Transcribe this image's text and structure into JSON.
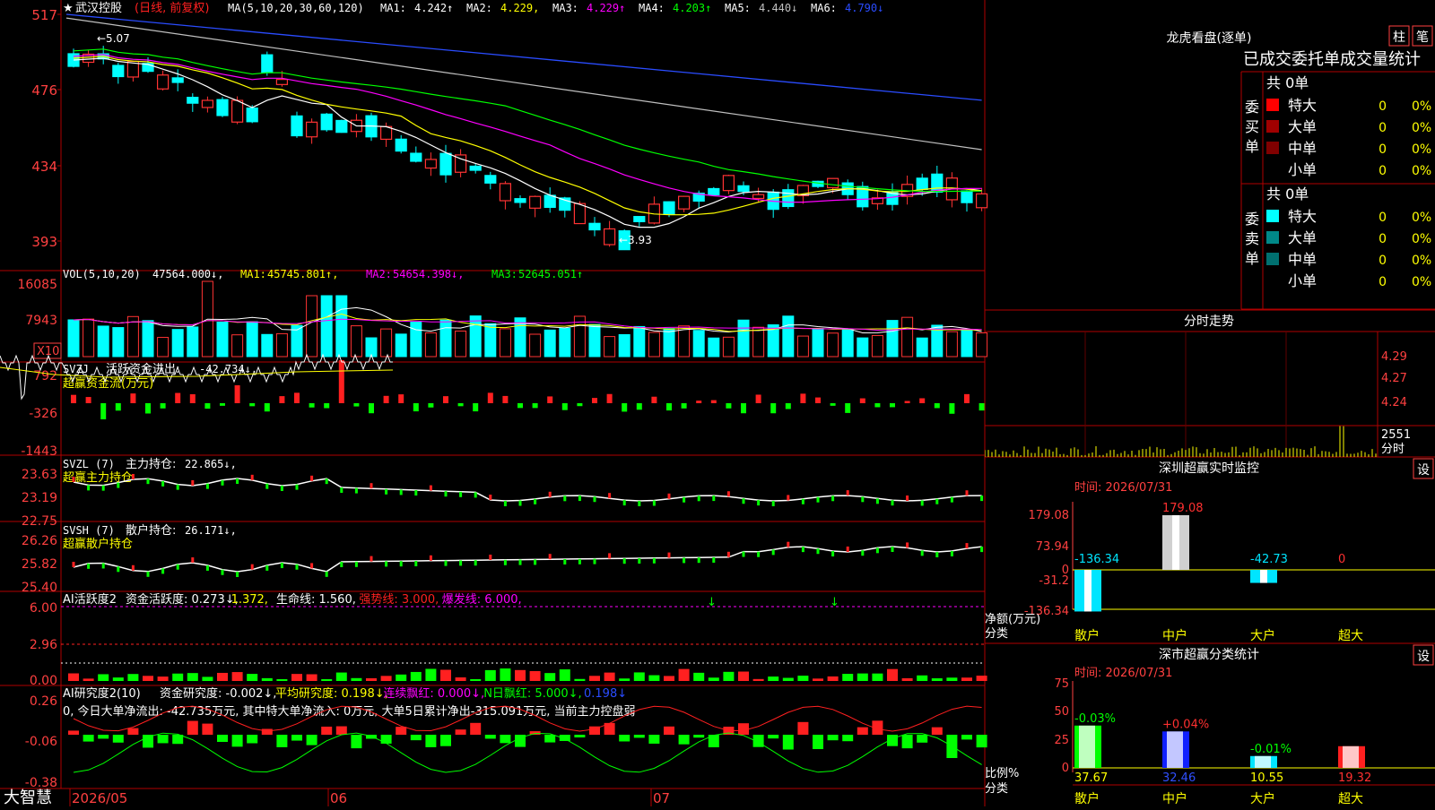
{
  "app": {
    "brand": "大智慧"
  },
  "kline_header": {
    "star": "★",
    "stock": "武汉控股",
    "mode": "(日线, 前复权)",
    "ma_title": "MA(5,10,20,30,60,120)",
    "items": [
      {
        "label": "MA1:",
        "value": "4.242↑",
        "color": "#ffffff"
      },
      {
        "label": "MA2:",
        "value": "4.229,",
        "color": "#ffff00"
      },
      {
        "label": "MA3:",
        "value": "4.229↑",
        "color": "#ff00ff"
      },
      {
        "label": "MA4:",
        "value": "4.203↑",
        "color": "#00ff00"
      },
      {
        "label": "MA5:",
        "value": "4.440↓",
        "color": "#c0c0c0"
      },
      {
        "label": "MA6:",
        "value": "4.790↓",
        "color": "#2a4cff"
      }
    ],
    "high_label": "←5.07",
    "low_label": "←3.93",
    "yaxis": [
      "517",
      "476",
      "434",
      "393"
    ]
  },
  "vol_header": {
    "title": "VOL(5,10,20)",
    "value": "47564.000↓,",
    "items": [
      {
        "label": "MA1:",
        "value": "45745.801↑,",
        "color": "#ffff00"
      },
      {
        "label": "MA2:",
        "value": "54654.398↓,",
        "color": "#ff00ff"
      },
      {
        "label": "MA3:",
        "value": "52645.051↑",
        "color": "#00ff00"
      }
    ],
    "yaxis": [
      "16085",
      "7943"
    ],
    "unit": "X10"
  },
  "svzj": {
    "title": "SVZJ",
    "desc": "活跃资金进出:",
    "value": "-42.734↓,",
    "sub": "超赢资金流(万元)",
    "yaxis": [
      "792",
      "-326",
      "-1443"
    ]
  },
  "svzl": {
    "title": "SVZL (7)",
    "desc": "主力持仓:",
    "value": "22.865↓,",
    "sub": "超赢主力持仓",
    "yaxis": [
      "23.63",
      "23.19",
      "22.75"
    ]
  },
  "svsh": {
    "title": "SVSH (7)",
    "desc": "散户持仓:",
    "value": "26.171↓,",
    "sub": "超赢散户持仓",
    "yaxis": [
      "26.26",
      "25.82",
      "25.40"
    ]
  },
  "ai1": {
    "title": "AI活跃度2",
    "parts": [
      {
        "t": "资金活跃度: 0.273↓,",
        "c": "#ffffff"
      },
      {
        "t": "1.372,",
        "c": "#ffff00"
      },
      {
        "t": "生命线: 1.560,",
        "c": "#ffffff"
      },
      {
        "t": "强势线: 3.000,",
        "c": "#ff2020"
      },
      {
        "t": "爆发线: 6.000,",
        "c": "#ff00ff"
      }
    ],
    "yaxis": [
      "6.00",
      "2.96",
      "0.00"
    ]
  },
  "ai2": {
    "title": "AI研究度2(10)",
    "parts": [
      {
        "t": "资金研究度: -0.002↓,",
        "c": "#ffffff"
      },
      {
        "t": "平均研究度: 0.198↓,",
        "c": "#ffff00"
      },
      {
        "t": "连续飘红: 0.000↓,",
        "c": "#ff00ff"
      },
      {
        "t": "N日飘红: 5.000↓,",
        "c": "#00ff00"
      },
      {
        "t": "0.198↓",
        "c": "#2a4cff"
      }
    ],
    "note": "0, 今日大单净流出: -42.735万元, 其中特大单净流入: 0万元, 大单5日累计净出-315.091万元, 当前主力控盘弱",
    "yaxis": [
      "0.26",
      "-0.06",
      "-0.38"
    ]
  },
  "xaxis": {
    "labels": [
      "2026/05",
      "06",
      "07"
    ]
  },
  "dragon": {
    "title": "龙虎看盘(逐单)",
    "tab1": "柱",
    "tab2": "笔",
    "subtitle": "已成交委托单成交量统计",
    "buy_label": "委买单",
    "sell_label": "委卖单",
    "buy_total": "共 0单",
    "sell_total": "共 0单",
    "buy_rows": [
      {
        "name": "特大",
        "count": "0",
        "pct": "0%",
        "color": "#ff0000"
      },
      {
        "name": "大单",
        "count": "0",
        "pct": "0%",
        "color": "#a00000"
      },
      {
        "name": "中单",
        "count": "0",
        "pct": "0%",
        "color": "#800000"
      },
      {
        "name": "小单",
        "count": "0",
        "pct": "0%",
        "color": ""
      }
    ],
    "sell_rows": [
      {
        "name": "特大",
        "count": "0",
        "pct": "0%",
        "color": "#00ffff"
      },
      {
        "name": "大单",
        "count": "0",
        "pct": "0%",
        "color": "#008888"
      },
      {
        "name": "中单",
        "count": "0",
        "pct": "0%",
        "color": "#007070"
      },
      {
        "name": "小单",
        "count": "0",
        "pct": "0%",
        "color": ""
      }
    ]
  },
  "intraday": {
    "title": "分时走势",
    "right_axis": [
      "4.29",
      "4.27",
      "4.24"
    ],
    "vol_label": "2551",
    "vol_unit": "分时"
  },
  "sz_monitor": {
    "title": "深圳超赢实时监控",
    "set": "设",
    "time": "时间: 2026/07/31",
    "yaxis": [
      "179.08",
      "73.94",
      "0",
      "-31.2",
      "-136.34"
    ],
    "bars": [
      {
        "cat": "散户",
        "value": "-136.34"
      },
      {
        "cat": "中户",
        "value": "179.08"
      },
      {
        "cat": "大户",
        "value": "-42.73"
      },
      {
        "cat": "超大",
        "value": "0"
      }
    ],
    "ylabel": "净额(万元)",
    "xlabel": "分类"
  },
  "sz_stats": {
    "title": "深市超赢分类统计",
    "set": "设",
    "time": "时间: 2026/07/31",
    "yaxis": [
      "75",
      "50",
      "25",
      "0"
    ],
    "bars": [
      {
        "cat": "散户",
        "value": "37.67",
        "change": "-0.03%"
      },
      {
        "cat": "中户",
        "value": "32.46",
        "change": "+0.04%"
      },
      {
        "cat": "大户",
        "value": "10.55",
        "change": "-0.01%"
      },
      {
        "cat": "超大",
        "value": "19.32",
        "change": ""
      }
    ],
    "ylabel": "比例%",
    "xlabel": "分类"
  },
  "colors": {
    "up": "#ff3333",
    "down": "#00ffff",
    "grid": "#b00000",
    "axis": "#ff4040"
  }
}
